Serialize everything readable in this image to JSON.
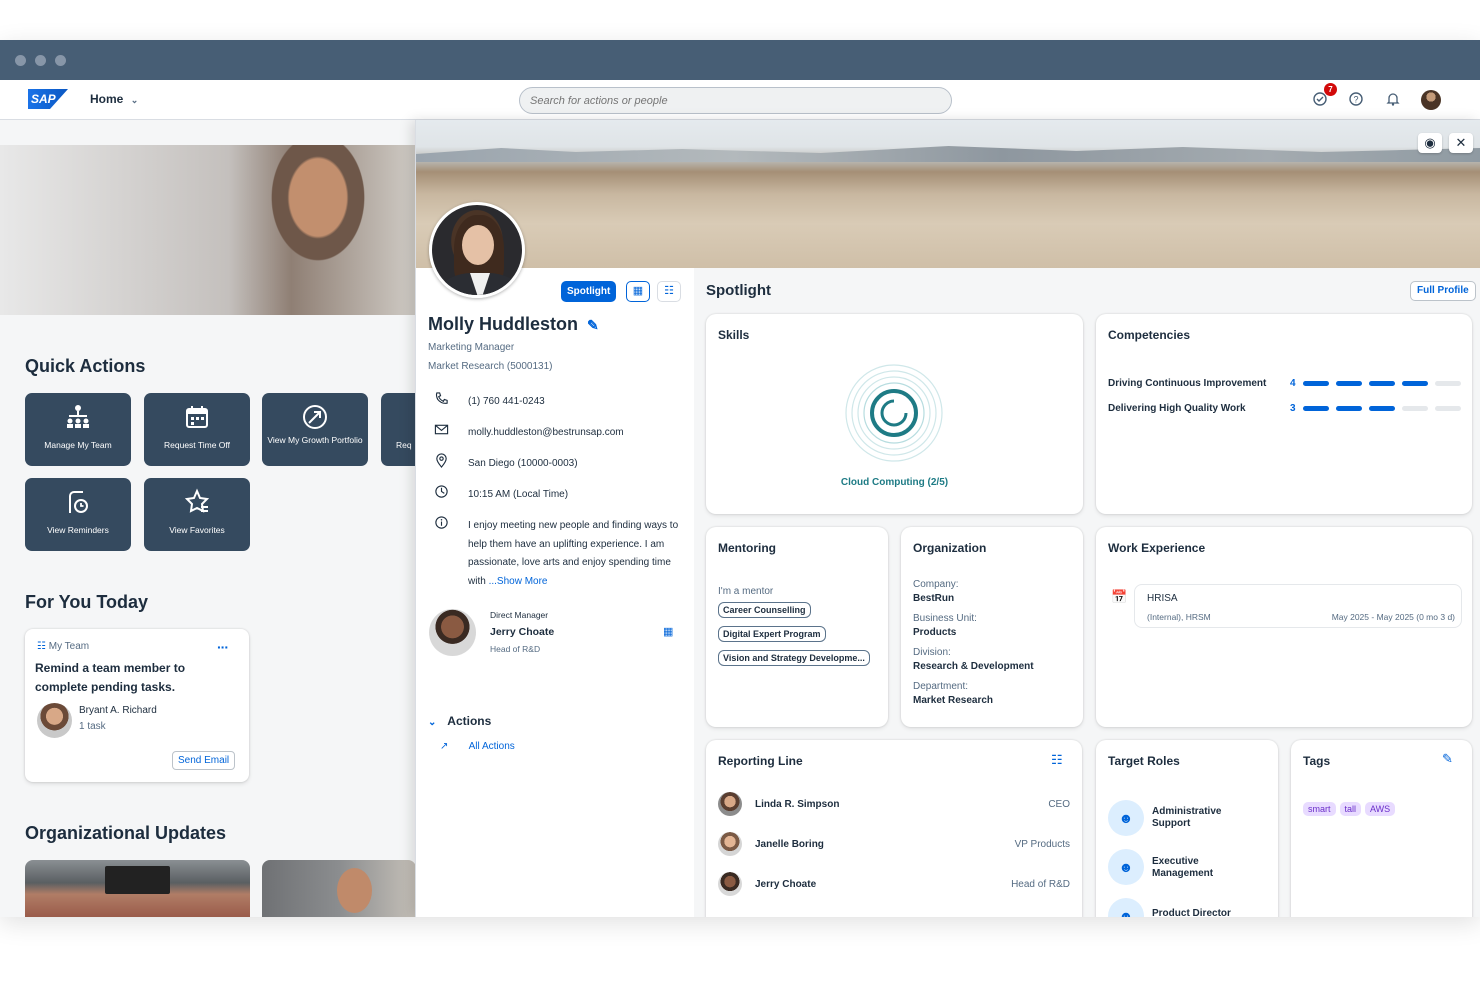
{
  "shell": {
    "logo": "SAP",
    "home_label": "Home",
    "search_placeholder": "Search for actions or people",
    "badge_count": "7"
  },
  "home": {
    "quick_actions_title": "Quick Actions",
    "tiles": [
      {
        "label": "Manage My Team",
        "icon": "org-chart-icon"
      },
      {
        "label": "Request Time Off",
        "icon": "calendar-icon"
      },
      {
        "label": "View My Growth Portfolio",
        "icon": "growth-icon"
      },
      {
        "label": "Req",
        "icon": "request-icon"
      },
      {
        "label": "View Reminders",
        "icon": "reminder-icon"
      },
      {
        "label": "View Favorites",
        "icon": "favorite-star-icon"
      }
    ],
    "for_you_title": "For You Today",
    "task_card": {
      "category": "My Team",
      "text": "Remind a team member to complete pending tasks.",
      "person": "Bryant A. Richard",
      "count": "1 task",
      "button": "Send Email"
    },
    "org_updates_title": "Organizational Updates"
  },
  "profile": {
    "spotlight_button": "Spotlight",
    "name": "Molly Huddleston",
    "job_title": "Marketing Manager",
    "department": "Market Research (5000131)",
    "phone": "(1) 760 441-0243",
    "email": "molly.huddleston@bestrunsap.com",
    "location": "San Diego (10000-0003)",
    "local_time": "10:15 AM (Local Time)",
    "bio": "I enjoy meeting new people and finding ways to help them have an uplifting experience. I am passionate, love arts and enjoy spending time with",
    "show_more": "...Show More",
    "manager_label": "Direct Manager",
    "manager_name": "Jerry Choate",
    "manager_title": "Head of R&D",
    "actions_label": "Actions",
    "all_actions": "All Actions"
  },
  "spotlight": {
    "title": "Spotlight",
    "full_profile": "Full Profile",
    "skills": {
      "title": "Skills",
      "skill": "Cloud Computing (2/5)"
    },
    "competencies": {
      "title": "Competencies",
      "items": [
        {
          "name": "Driving Continuous Improvement",
          "level": "4",
          "filled": 4,
          "total": 5
        },
        {
          "name": "Delivering High Quality Work",
          "level": "3",
          "filled": 3,
          "total": 5
        }
      ]
    },
    "mentoring": {
      "title": "Mentoring",
      "label": "I'm a mentor",
      "programs": [
        "Career Counselling",
        "Digital Expert Program",
        "Vision and Strategy Developme..."
      ]
    },
    "organization": {
      "title": "Organization",
      "company_label": "Company:",
      "company": "BestRun",
      "bu_label": "Business Unit:",
      "bu": "Products",
      "division_label": "Division:",
      "division": "Research & Development",
      "department_label": "Department:",
      "department": "Market Research"
    },
    "work_experience": {
      "title": "Work Experience",
      "company": "HRISA",
      "detail": "(Internal), HRSM",
      "period": "May 2025 - May 2025 (0 mo 3 d)"
    },
    "reporting_line": {
      "title": "Reporting Line",
      "people": [
        {
          "name": "Linda R. Simpson",
          "title": "CEO"
        },
        {
          "name": "Janelle Boring",
          "title": "VP Products"
        },
        {
          "name": "Jerry Choate",
          "title": "Head of R&D"
        }
      ]
    },
    "target_roles": {
      "title": "Target Roles",
      "roles": [
        "Administrative Support",
        "Executive Management",
        "Product Director"
      ]
    },
    "tags": {
      "title": "Tags",
      "items": [
        "smart",
        "tall",
        "AWS"
      ]
    }
  },
  "colors": {
    "shell_header": "#475e75",
    "tile_bg": "#354a5f",
    "accent": "#0064d9",
    "competency_filled": "#0064d9",
    "competency_empty": "#e5e8eb",
    "tag_bg": "#e8dbff",
    "skill_ring": "#1e7b85"
  }
}
